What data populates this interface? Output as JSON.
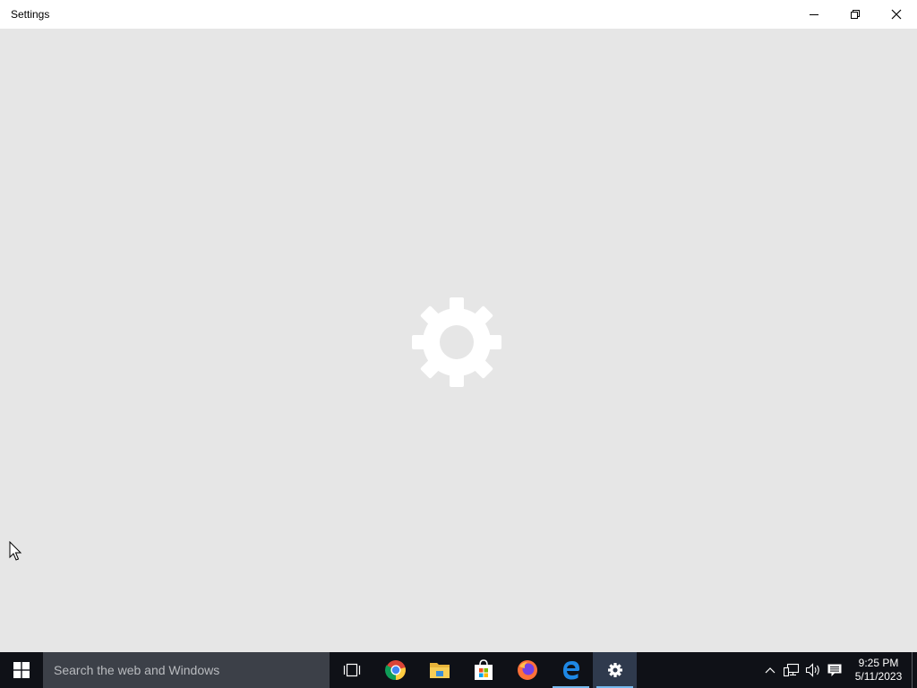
{
  "window": {
    "title": "Settings",
    "controls": {
      "minimize": "minimize-icon",
      "restore": "restore-icon",
      "close": "close-icon"
    }
  },
  "content": {
    "splash_icon": "gear-icon",
    "background": "#e6e6e6"
  },
  "taskbar": {
    "search_placeholder": "Search the web and Windows",
    "apps": [
      {
        "name": "task-view-icon",
        "running": false,
        "active": false
      },
      {
        "name": "chrome-icon",
        "running": false,
        "active": false
      },
      {
        "name": "file-explorer-icon",
        "running": false,
        "active": false
      },
      {
        "name": "store-icon",
        "running": false,
        "active": false
      },
      {
        "name": "firefox-icon",
        "running": false,
        "active": false
      },
      {
        "name": "edge-icon",
        "running": true,
        "active": false
      },
      {
        "name": "settings-icon",
        "running": true,
        "active": true
      }
    ],
    "tray": [
      "chevron-up-icon",
      "network-icon",
      "volume-icon",
      "notification-icon"
    ],
    "clock": {
      "time": "9:25 PM",
      "date": "5/11/2023"
    },
    "colors": {
      "taskbar_bg": "#0f1117",
      "search_bg": "#3c4048",
      "running_indicator": "#76b9ed",
      "accent": "#0078d7"
    }
  }
}
